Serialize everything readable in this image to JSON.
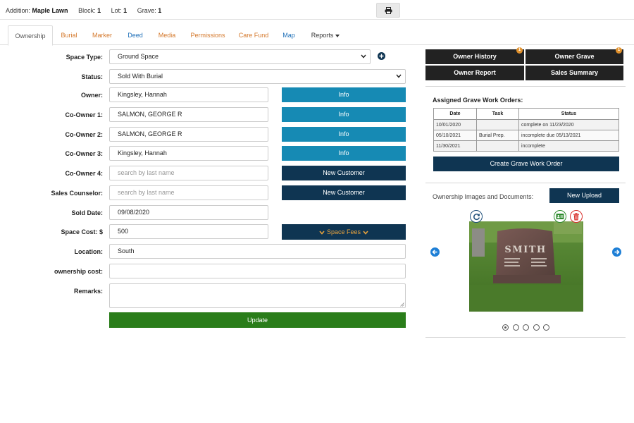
{
  "header": {
    "addition_label": "Addition:",
    "addition_value": "Maple Lawn",
    "block_label": "Block:",
    "block_value": "1",
    "lot_label": "Lot:",
    "lot_value": "1",
    "grave_label": "Grave:",
    "grave_value": "1",
    "print_icon": "printer-icon"
  },
  "tabs": [
    {
      "label": "Ownership",
      "active": true
    },
    {
      "label": "Burial"
    },
    {
      "label": "Marker"
    },
    {
      "label": "Deed"
    },
    {
      "label": "Media"
    },
    {
      "label": "Permissions"
    },
    {
      "label": "Care Fund"
    },
    {
      "label": "Map"
    },
    {
      "label": "Reports"
    }
  ],
  "form": {
    "space_type": {
      "label": "Space Type:",
      "value": "Ground Space"
    },
    "status": {
      "label": "Status:",
      "value": "Sold With Burial"
    },
    "owner": {
      "label": "Owner:",
      "value": "Kingsley, Hannah",
      "button": "Info"
    },
    "co_owner_1": {
      "label": "Co-Owner 1:",
      "value": "SALMON, GEORGE R",
      "button": "Info"
    },
    "co_owner_2": {
      "label": "Co-Owner 2:",
      "value": "SALMON, GEORGE R",
      "button": "Info"
    },
    "co_owner_3": {
      "label": "Co-Owner 3:",
      "value": "Kingsley, Hannah",
      "button": "Info"
    },
    "co_owner_4": {
      "label": "Co-Owner 4:",
      "value": "",
      "placeholder": "search by last name",
      "button": "New Customer"
    },
    "sales_counselor": {
      "label": "Sales Counselor:",
      "value": "",
      "placeholder": "search by last name",
      "button": "New Customer"
    },
    "sold_date": {
      "label": "Sold Date:",
      "value": "09/08/2020"
    },
    "space_cost": {
      "label": "Space Cost: $",
      "value": "500",
      "button": "Space Fees"
    },
    "location": {
      "label": "Location:",
      "value": "South"
    },
    "ownership_cost": {
      "label": "ownership cost:",
      "value": ""
    },
    "remarks": {
      "label": "Remarks:",
      "value": ""
    },
    "update_button": "Update"
  },
  "right_panel": {
    "buttons": {
      "owner_history": "Owner History",
      "owner_history_badge": "1",
      "owner_grave": "Owner Grave",
      "owner_grave_badge": "1",
      "owner_report": "Owner Report",
      "sales_summary": "Sales Summary"
    },
    "work_orders": {
      "title": "Assigned Grave Work Orders:",
      "columns": [
        "Date",
        "Task",
        "Status"
      ],
      "rows": [
        [
          "10/01/2020",
          "",
          "complete on 11/23/2020"
        ],
        [
          "05/10/2021",
          "Burial Prep.",
          "incomplete due 05/13/2021"
        ],
        [
          "11/30/2021",
          "",
          "incomplete"
        ]
      ],
      "create_button": "Create Grave Work Order"
    },
    "images": {
      "label": "Ownership Images and Documents:",
      "upload_button": "New Upload",
      "gravestone_text": "SMITH",
      "dot_count": 5,
      "active_dot": 0
    }
  },
  "colors": {
    "accent_orange": "#d4782b",
    "info_blue": "#168ab4",
    "navy": "#0f3552",
    "update_green": "#2a7d1a",
    "dark_button": "#222222"
  }
}
